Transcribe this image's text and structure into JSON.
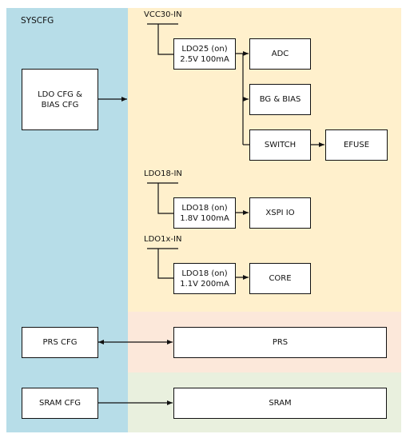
{
  "diagram": {
    "title": "SYSCFG",
    "regions": {
      "syscfg": "#b7dde8",
      "ldo": "#fff0cc",
      "prs": "#fce8da",
      "sram": "#e9f0de"
    },
    "inputs": {
      "vcc30": "VCC30-IN",
      "ldo18": "LDO18-IN",
      "ldo1x": "LDO1x-IN"
    },
    "blocks": {
      "ldo_cfg": "LDO CFG &\nBIAS CFG",
      "ldo25": "LDO25 (on)\n2.5V 100mA",
      "adc": "ADC",
      "bg_bias": "BG & BIAS",
      "switch": "SWITCH",
      "efuse": "EFUSE",
      "ldo18_a": "LDO18 (on)\n1.8V 100mA",
      "xspi_io": "XSPI IO",
      "ldo18_b": "LDO18 (on)\n1.1V 200mA",
      "core": "CORE",
      "prs_cfg": "PRS CFG",
      "prs": "PRS",
      "sram_cfg": "SRAM CFG",
      "sram": "SRAM"
    }
  }
}
